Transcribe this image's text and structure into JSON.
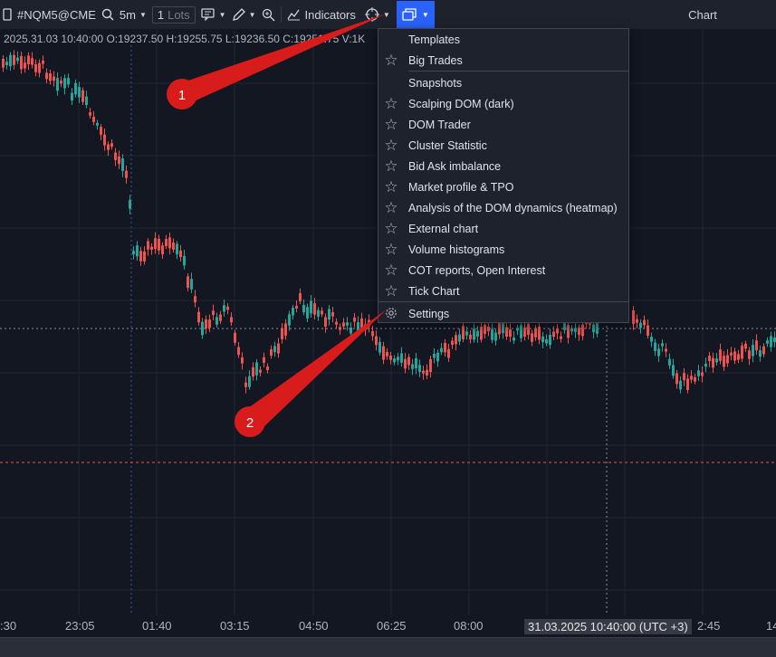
{
  "toolbar": {
    "symbol": "#NQM5@CME",
    "timeframe": "5m",
    "lots_value": "1",
    "lots_unit": "Lots",
    "indicators_label": "Indicators",
    "chart_tab": "Chart"
  },
  "ohlc_text": "2025.31.03 10:40:00 O:19237.50 H:19255.75 L:19236.50 C:19251.75 V:1K",
  "menu": {
    "items": [
      {
        "label": "Templates",
        "icon": "none"
      },
      {
        "label": "Big Trades",
        "icon": "star-outline-icon"
      },
      {
        "label": "Snapshots",
        "icon": "none"
      },
      {
        "label": "Scalping DOM (dark)",
        "icon": "star-outline-icon"
      },
      {
        "label": "DOM Trader",
        "icon": "star-outline-icon"
      },
      {
        "label": "Cluster Statistic",
        "icon": "star-outline-icon"
      },
      {
        "label": "Bid Ask imbalance",
        "icon": "star-outline-icon"
      },
      {
        "label": "Market profile & TPO",
        "icon": "star-outline-icon"
      },
      {
        "label": "Analysis of the DOM dynamics (heatmap)",
        "icon": "star-outline-icon"
      },
      {
        "label": "External chart",
        "icon": "star-outline-icon"
      },
      {
        "label": "Volume histograms",
        "icon": "star-outline-icon"
      },
      {
        "label": "COT reports, Open Interest",
        "icon": "star-outline-icon"
      },
      {
        "label": "Tick Chart",
        "icon": "star-outline-icon"
      },
      {
        "label": "Settings",
        "icon": "gear-icon"
      }
    ]
  },
  "time_axis": {
    "labels": [
      ":30",
      "23:05",
      "01:40",
      "03:15",
      "04:50",
      "06:25",
      "08:00",
      "2:45",
      "14"
    ],
    "highlight": "31.03.2025 10:40:00 (UTC +3)"
  },
  "annotations": {
    "marker_1": "1",
    "marker_2": "2"
  },
  "colors": {
    "background": "#131722",
    "toolbar": "#1e222d",
    "accent": "#2962ff",
    "bull_candle": "#26a69a",
    "bear_candle": "#ef5350",
    "annotation": "#d81b1b"
  }
}
